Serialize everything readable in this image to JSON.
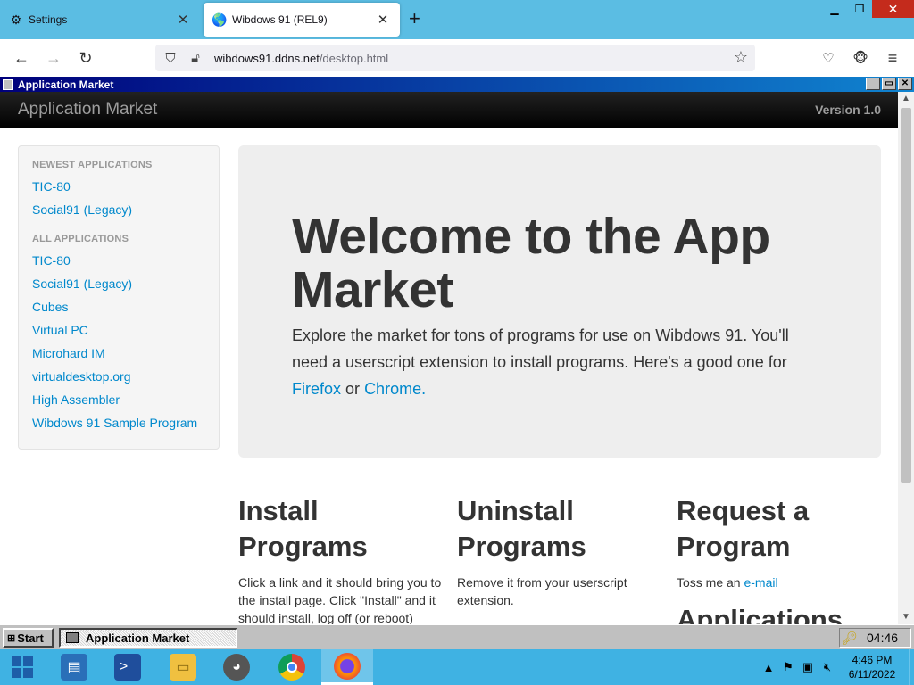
{
  "browser": {
    "tabs": [
      {
        "title": "Settings",
        "icon": "gear-icon",
        "active": false
      },
      {
        "title": "Wibdows 91 (REL9)",
        "icon": "globe-icon",
        "active": true
      }
    ],
    "url_host": "wibdows91.ddns.net",
    "url_path": "/desktop.html"
  },
  "app_window": {
    "title": "Application Market"
  },
  "app": {
    "brand": "Application Market",
    "version": "Version 1.0",
    "sidebar": {
      "newest_header": "NEWEST APPLICATIONS",
      "newest": [
        "TIC-80",
        "Social91 (Legacy)"
      ],
      "all_header": "ALL APPLICATIONS",
      "all": [
        "TIC-80",
        "Social91 (Legacy)",
        "Cubes",
        "Virtual PC",
        "Microhard IM",
        "virtualdesktop.org",
        "High Assembler",
        "Wibdows 91 Sample Program"
      ]
    },
    "hero": {
      "heading": "Welcome to the App Market",
      "text": "Explore the market for tons of programs for use on Wibdows 91. You'll need a userscript extension to install programs. Here's a good one for",
      "firefox_link": "Firefox",
      "or": "or",
      "chrome_link": "Chrome."
    },
    "columns": {
      "install": {
        "heading": "Install Programs",
        "text": "Click a link and it should bring you to the install page. Click \"Install\" and it should install, log off (or reboot)"
      },
      "uninstall": {
        "heading": "Uninstall Programs",
        "text": "Remove it from your userscript extension."
      },
      "request": {
        "heading": "Request a Program",
        "text_prefix": "Toss me an",
        "email_link": "e-mail",
        "next_heading": "Applications"
      }
    }
  },
  "retro_taskbar": {
    "start_label": "Start",
    "task_label": "Application Market",
    "clock": "04:46"
  },
  "windows_taskbar": {
    "time": "4:46 PM",
    "date": "6/11/2022"
  }
}
